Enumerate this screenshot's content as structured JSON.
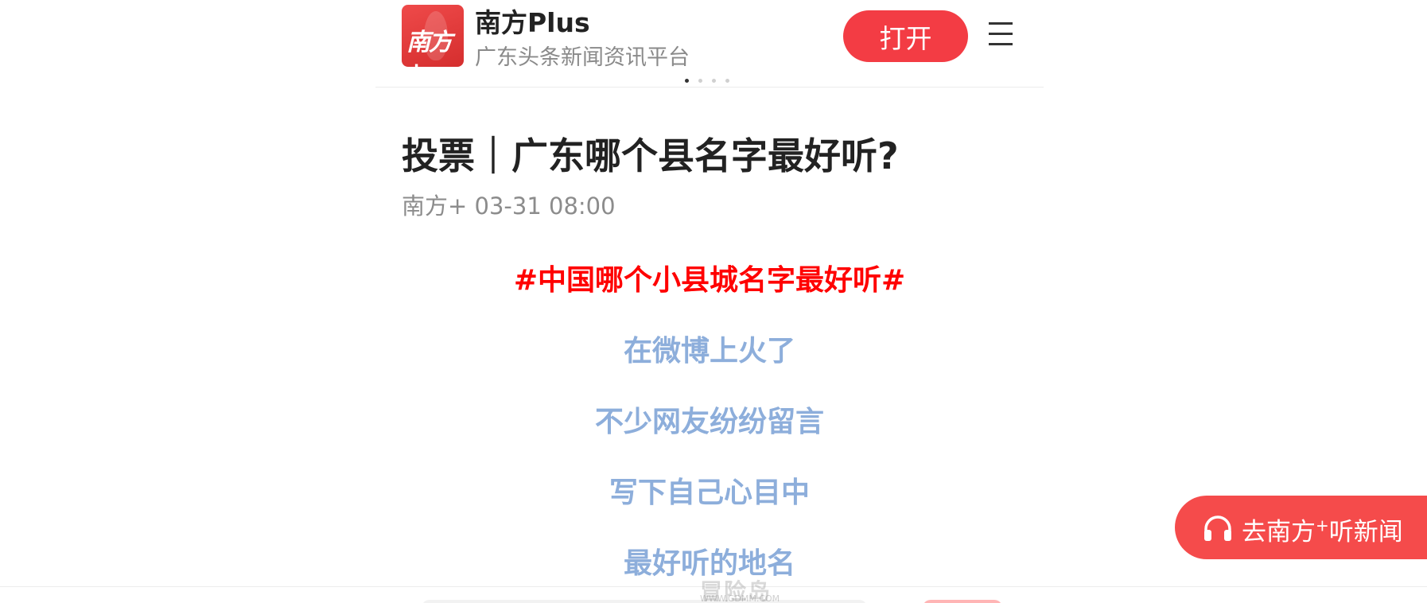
{
  "header": {
    "logo_text": "南方+",
    "app_name": "南方Plus",
    "app_slogan": "广东头条新闻资讯平台",
    "open_label": "打开",
    "menu_icon": "hamburger-menu-icon"
  },
  "article": {
    "title": "投票｜广东哪个县名字最好听?",
    "meta": "南方+ 03-31 08:00",
    "paragraphs": [
      "#中国哪个小县城名字最好听#",
      "在微博上火了",
      "不少网友纷纷留言",
      "写下自己心目中",
      "最好听的地名"
    ]
  },
  "listen": {
    "label_prefix": "去南方",
    "label_sup": "+",
    "label_suffix": "听新闻"
  },
  "watermark": {
    "text": "冒险岛",
    "url": "WWW.GDMM.COM"
  },
  "colors": {
    "brand_red": "#f33c44",
    "headline_red": "#ff0000",
    "body_blue": "#8daedb"
  }
}
